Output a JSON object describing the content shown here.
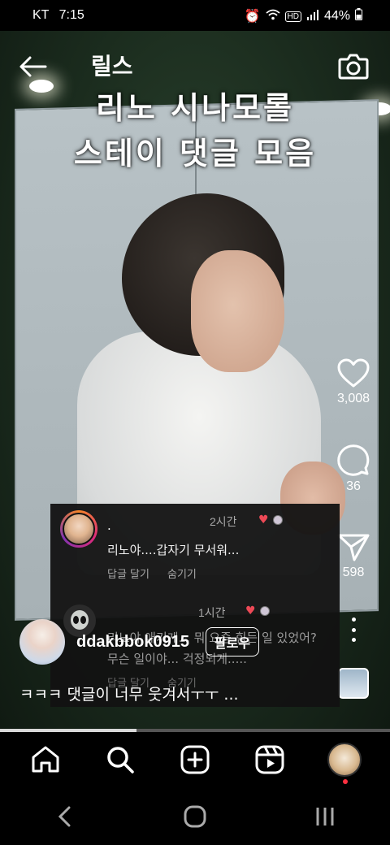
{
  "status_bar": {
    "carrier": "KT",
    "time": "7:15",
    "network_badge": "HD",
    "battery": "44%"
  },
  "header": {
    "title": "릴스",
    "back_icon": "arrow-left-icon",
    "camera_icon": "camera-icon"
  },
  "video": {
    "caption_line1": "리노 시나모롤",
    "caption_line2": "스테이 댓글 모음"
  },
  "comments": [
    {
      "user": ".",
      "time": "2시간",
      "text": "리노야....갑자기 무서워...",
      "reply": "답글 달기",
      "hide": "숨기기"
    },
    {
      "user": "",
      "time": "1시간",
      "text": "리노야 애기게... 뭐 요즘 힘든 일 있었어? 무슨 일이야... 걱정되게.....",
      "reply": "답글 달기",
      "hide": "숨기기"
    }
  ],
  "actions": {
    "likes": "3,008",
    "comments": "36",
    "shares": "598"
  },
  "post": {
    "username": "ddakbbok0915",
    "follow_label": "팔로우",
    "caption": "ㅋㅋㅋ 댓글이 너무 웃겨서ㅜㅜ ..."
  },
  "playback": {
    "progress": 0.35
  },
  "bottom_nav": [
    "home-icon",
    "search-icon",
    "create-icon",
    "reels-icon",
    "profile-avatar"
  ],
  "system_nav": [
    "back-chevron-icon",
    "home-circle-icon",
    "recents-icon"
  ],
  "colors": {
    "like": "#ed4956",
    "notification": "#ff3040"
  }
}
